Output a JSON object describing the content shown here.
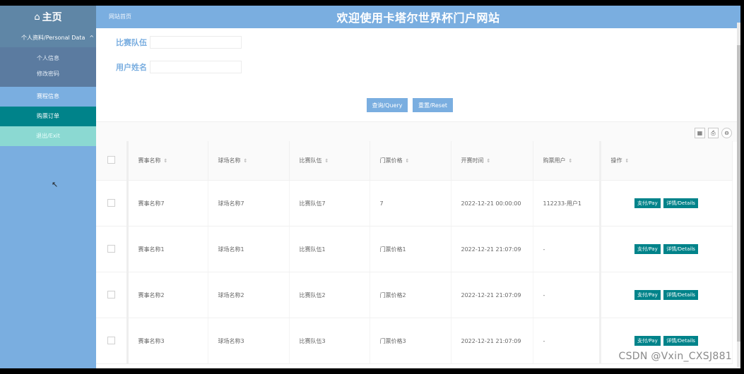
{
  "header": {
    "brand_icon": "home-icon",
    "brand": "主页",
    "breadcrumb": "网站首页",
    "title": "欢迎使用卡塔尔世界杯门户网站"
  },
  "sidebar": {
    "group": "个人资料/Personal Data",
    "group_chevron": "chevron-up-icon",
    "sub_items": [
      "个人信息",
      "修改密码"
    ],
    "items": [
      {
        "label": "赛程信息",
        "state": "normal"
      },
      {
        "label": "购票订单",
        "state": "active"
      },
      {
        "label": "退出/Exit",
        "state": "exit"
      }
    ]
  },
  "search": {
    "team_label": "比赛队伍",
    "team_value": "",
    "user_label": "用户姓名",
    "user_value": "",
    "query_button": "查询/Query",
    "reset_button": "重置/Reset"
  },
  "toolbar": {
    "icons": [
      "columns-icon",
      "print-icon",
      "export-icon"
    ]
  },
  "table": {
    "columns": [
      "赛事名称",
      "球场名称",
      "比赛队伍",
      "门票价格",
      "开赛时间",
      "购票用户",
      "操作"
    ],
    "rows": [
      [
        "赛事名称7",
        "球场名称7",
        "比赛队伍7",
        "7",
        "2022-12-21 00:00:00",
        "112233-用户1"
      ],
      [
        "赛事名称1",
        "球场名称1",
        "比赛队伍1",
        "门票价格1",
        "2022-12-21 21:07:09",
        "-"
      ],
      [
        "赛事名称2",
        "球场名称2",
        "比赛队伍2",
        "门票价格2",
        "2022-12-21 21:07:09",
        "-"
      ],
      [
        "赛事名称3",
        "球场名称3",
        "比赛队伍3",
        "门票价格3",
        "2022-12-21 21:07:09",
        "-"
      ]
    ],
    "pay_label": "支付/Pay",
    "details_label": "详情/Details"
  },
  "watermark": "CSDN @Vxin_CXSJ881",
  "colors": {
    "accent": "#7aaee0",
    "sidebar_dark": "#5f86a6",
    "active": "#00838a",
    "exit": "#8bd9d2"
  }
}
